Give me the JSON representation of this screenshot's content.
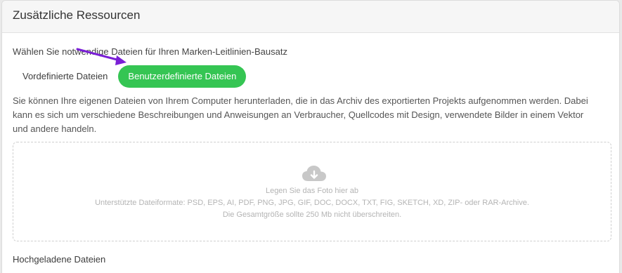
{
  "header": {
    "title": "Zusätzliche Ressourcen"
  },
  "section": {
    "subtitle": "Wählen Sie notwendige Dateien für Ihren Marken-Leitlinien-Bausatz",
    "tabs": [
      {
        "label": "Vordefinierte Dateien",
        "active": false
      },
      {
        "label": "Benutzerdefinierte Dateien",
        "active": true
      }
    ],
    "description": "Sie können Ihre eigenen Dateien von Ihrem Computer herunterladen, die in das Archiv des exportierten Projekts aufgenommen werden. Dabei kann es sich um verschiedene Beschreibungen und Anweisungen an Verbraucher, Quellcodes mit Design, verwendete Bilder in einem Vektor und andere handeln."
  },
  "dropzone": {
    "icon": "cloud-upload-icon",
    "line1": "Legen Sie das Foto hier ab",
    "line2": "Unterstützte Dateiformate: PSD, EPS, AI, PDF, PNG, JPG, GIF, DOC, DOCX, TXT, FIG, SKETCH, XD, ZIP- oder RAR-Archive.",
    "line3": "Die Gesamtgröße sollte 250 Mb nicht überschreiten."
  },
  "uploaded": {
    "title": "Hochgeladene Dateien"
  },
  "colors": {
    "accent": "#35c553",
    "annotation_arrow": "#7a1fd6"
  }
}
